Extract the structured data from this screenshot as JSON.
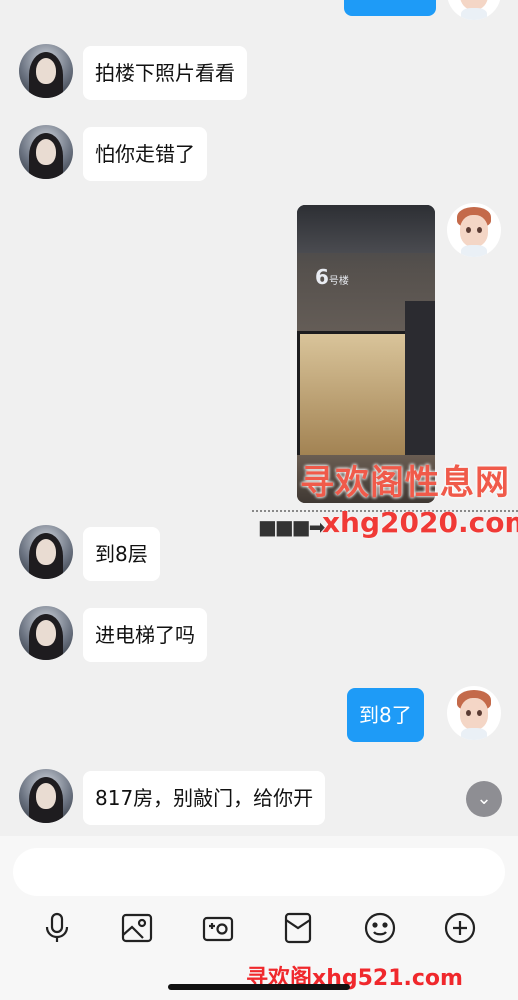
{
  "messages": [
    {
      "side": "left",
      "text": "拍楼下照片看看"
    },
    {
      "side": "left",
      "text": "怕你走错了"
    },
    {
      "side": "right",
      "text": "到8了"
    },
    {
      "side": "left",
      "text": "到8层"
    },
    {
      "side": "left",
      "text": "进电梯了吗"
    },
    {
      "side": "left",
      "text": "817房，别敲门，给你开"
    }
  ],
  "photo_sign": {
    "number": "6",
    "label": "号楼"
  },
  "watermark": {
    "site_name": "寻欢阁性息网",
    "site_url": "xhg2020.com",
    "bottom_url": "寻欢阁xhg521.com"
  },
  "toolbar_icons": [
    "microphone-icon",
    "image-icon",
    "camera-icon",
    "red-packet-icon",
    "emoji-icon",
    "plus-icon"
  ],
  "colors": {
    "right_bubble": "#1e9bf7",
    "background": "#f0f0f0"
  }
}
